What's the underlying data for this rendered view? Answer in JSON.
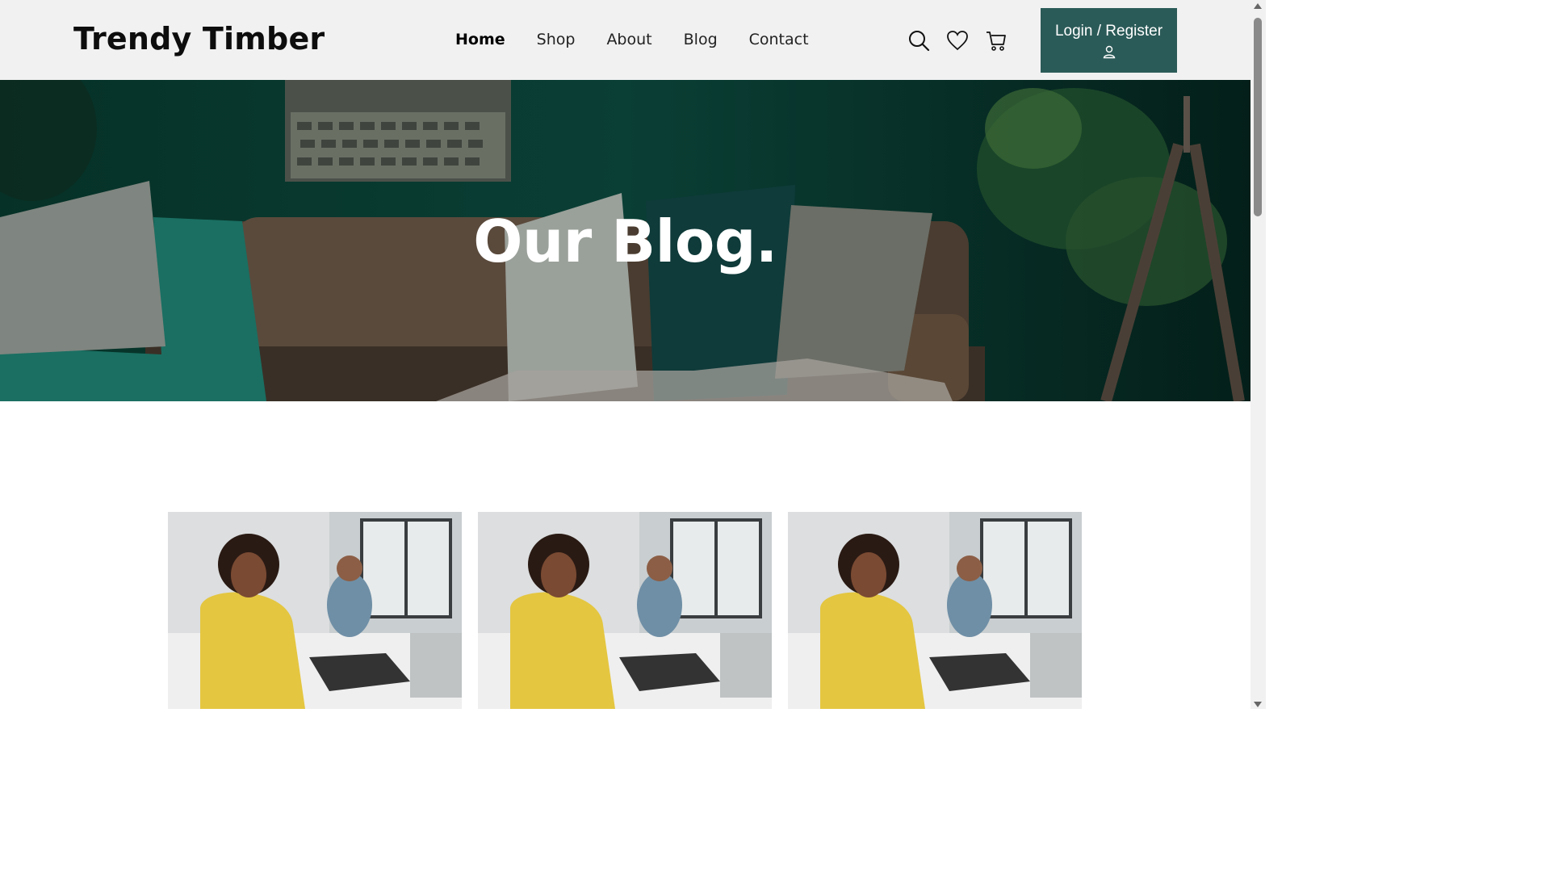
{
  "header": {
    "logo": "Trendy Timber",
    "nav": [
      {
        "label": "Home",
        "active": true
      },
      {
        "label": "Shop"
      },
      {
        "label": "About"
      },
      {
        "label": "Blog"
      },
      {
        "label": "Contact"
      }
    ],
    "icons": [
      "search-icon",
      "heart-icon",
      "cart-icon"
    ],
    "login_label": "Login / Register",
    "login_icon": "user-icon"
  },
  "hero": {
    "title": "Our Blog."
  },
  "cards": [
    {
      "image": "woman-with-headset-at-computer"
    },
    {
      "image": "woman-with-headset-at-computer"
    },
    {
      "image": "woman-with-headset-at-computer"
    }
  ],
  "colors": {
    "header_bg": "#f1f1f1",
    "accent": "#2b5b58",
    "hero_bg": "#073a30"
  }
}
